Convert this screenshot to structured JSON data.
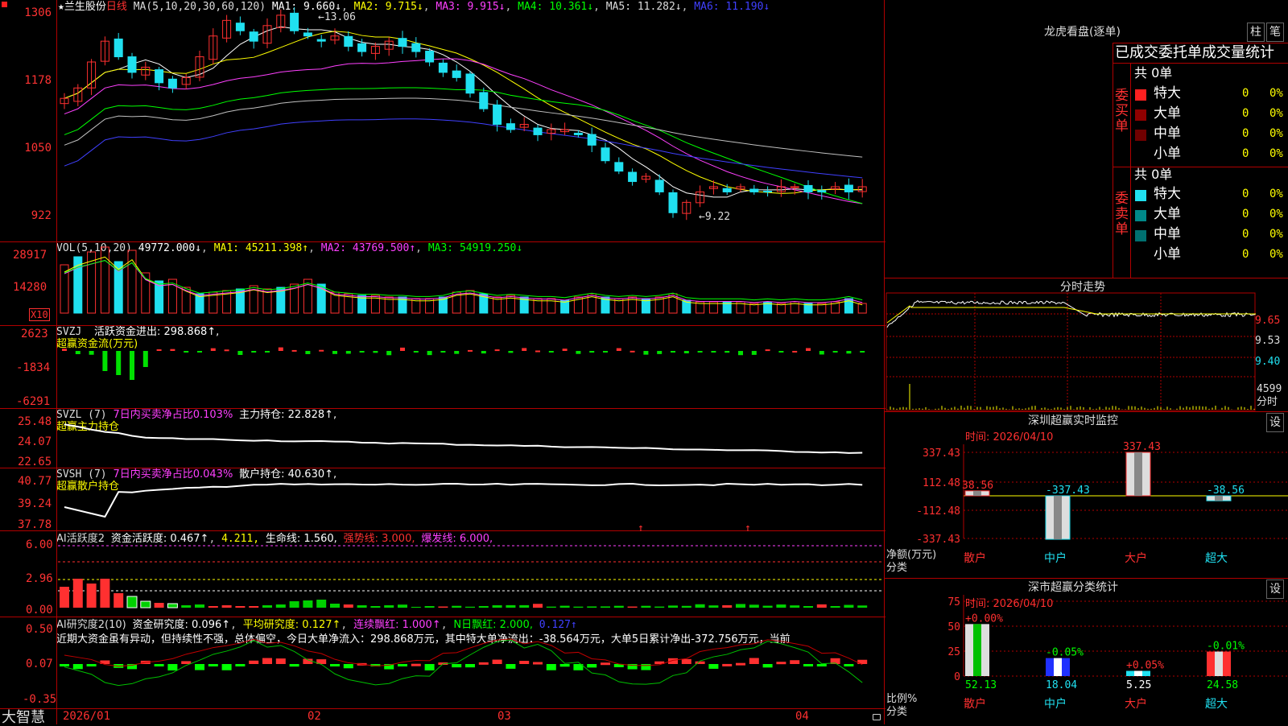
{
  "colors": {
    "up": "#ff3030",
    "down": "#20e0f0",
    "grid": "#b00000",
    "ma1": "#ffffff",
    "ma2": "#ffff00",
    "ma3": "#ff40ff",
    "ma4": "#00ff00",
    "ma5": "#c0c0c0",
    "ma6": "#4040ff"
  },
  "main": {
    "star": "★",
    "name": "兰生股份",
    "period": "日线",
    "ma_header": "MA(5,10,20,30,60,120)",
    "ma1": "MA1: 9.660↓",
    "ma2": "MA2: 9.715↓",
    "ma3": "MA3: 9.915↓",
    "ma4": "MA4: 10.361↓",
    "ma5": "MA5: 11.282↓",
    "ma6": "MA6: 11.190↓",
    "yticks": [
      "1306",
      "1178",
      "1050",
      "922"
    ],
    "high_mark": "13.06",
    "low_mark": "9.22"
  },
  "vol": {
    "header": "VOL(5,10,20)",
    "value": "49772.000↓",
    "ma1": "MA1: 45211.398↑",
    "ma2": "MA2: 43769.500↑",
    "ma3": "MA3: 54919.250↓",
    "yticks": [
      "28917",
      "14280"
    ],
    "unit": "X10"
  },
  "svzj": {
    "header": "SVZJ",
    "title": "活跃资金进出: 298.868↑,",
    "subtitle": "超赢资金流(万元)",
    "yticks": [
      "2623",
      "-1834",
      "-6291"
    ]
  },
  "svzl": {
    "header": "SVZL (7)",
    "ratio": "7日内买卖净占比0.103%",
    "main": "主力持仓: 22.828↑,",
    "subtitle": "超赢主力持仓",
    "yticks": [
      "25.48",
      "24.07",
      "22.65"
    ]
  },
  "svsh": {
    "header": "SVSH (7)",
    "ratio": "7日内买卖净占比0.043%",
    "retail": "散户持仓: 40.630↑,",
    "subtitle": "超赢散户持仓",
    "yticks": [
      "40.77",
      "39.24",
      "37.78"
    ]
  },
  "ai1": {
    "header": "AI活跃度2",
    "a": "资金活跃度: 0.467↑",
    "b": "4.211,",
    "c": "生命线: 1.560,",
    "d": "强势线: 3.000,",
    "e": "爆发线: 6.000,",
    "yticks": [
      "6.00",
      "2.96",
      "0.00"
    ]
  },
  "ai2": {
    "header": "AI研究度2(10)",
    "a": "资金研究度: 0.096↑",
    "b": "平均研究度: 0.127↑",
    "c": "连续飘红: 1.000↑",
    "d": "N日飘红: 2.000,",
    "e": "0.127↑",
    "text": "近期大资金虽有异动，但持续性不强，总体偏空，今日大单净流入：298.868万元，其中特大单净流出：-38.564万元，大单5日累计净出-372.756万元，当前",
    "yticks": [
      "0.50",
      "0.07",
      "-0.35"
    ]
  },
  "bottom": {
    "brand": "大智慧",
    "dates": [
      "2026/01",
      "02",
      "03",
      "04"
    ]
  },
  "dragon": {
    "title": "龙虎看盘(逐单)",
    "btn1": "柱",
    "btn2": "笔",
    "subtitle": "已成交委托单成交量统计",
    "buy": {
      "label": "委买单",
      "total": "共 0单",
      "rows": [
        {
          "name": "特大",
          "qty": "0",
          "pct": "0%"
        },
        {
          "name": "大单",
          "qty": "0",
          "pct": "0%"
        },
        {
          "name": "中单",
          "qty": "0",
          "pct": "0%"
        },
        {
          "name": "小单",
          "qty": "0",
          "pct": "0%"
        }
      ]
    },
    "sell": {
      "label": "委卖单",
      "total": "共 0单",
      "rows": [
        {
          "name": "特大",
          "qty": "0",
          "pct": "0%"
        },
        {
          "name": "大单",
          "qty": "0",
          "pct": "0%"
        },
        {
          "name": "中单",
          "qty": "0",
          "pct": "0%"
        },
        {
          "name": "小单",
          "qty": "0",
          "pct": "0%"
        }
      ]
    }
  },
  "minute": {
    "title": "分时走势",
    "yticks": [
      "9.65",
      "9.53",
      "9.40"
    ],
    "vol": "4599",
    "vol_label": "分时"
  },
  "sz_monitor": {
    "title": "深圳超赢实时监控",
    "btn": "设",
    "time": "时间: 2026/04/10",
    "yticks": [
      "337.43",
      "112.48",
      "-112.48",
      "-337.43"
    ],
    "ylabel": "净额(万元)",
    "xlabel": "分类",
    "categories": [
      "散户",
      "中户",
      "大户",
      "超大"
    ],
    "values": [
      "38.56",
      "-337.43",
      "337.43",
      "-38.56"
    ]
  },
  "sz_class": {
    "title": "深市超赢分类统计",
    "btn": "设",
    "time": "时间: 2026/04/10",
    "yticks": [
      "75",
      "50",
      "25",
      "0"
    ],
    "ylabel": "比例%",
    "xlabel": "分类",
    "categories": [
      "散户",
      "中户",
      "大户",
      "超大"
    ],
    "values": [
      "52.13",
      "18.04",
      "5.25",
      "24.58"
    ],
    "changes": [
      "+0.00%",
      "-0.05%",
      "+0.05%",
      "-0.01%"
    ]
  }
}
